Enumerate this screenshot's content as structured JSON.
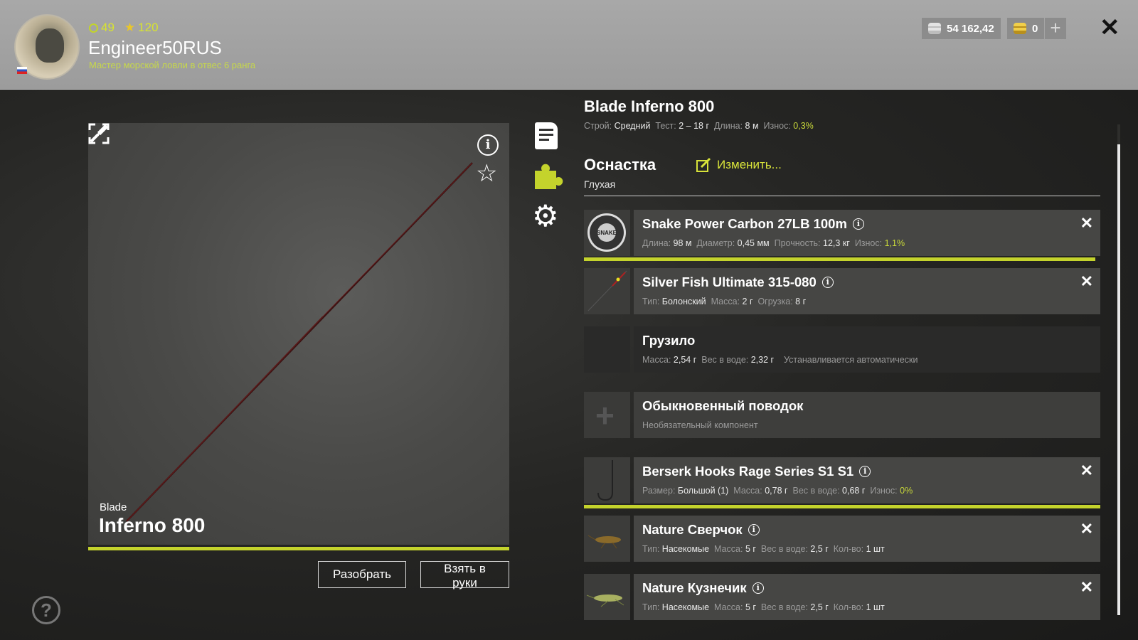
{
  "header": {
    "level": "49",
    "stars": "120",
    "username": "Engineer50RUS",
    "rank": "Мастер морской ловли в отвес 6 ранга",
    "silver": "54 162,42",
    "gold": "0",
    "add_label": "+",
    "close_label": "✕"
  },
  "preview": {
    "brand": "Blade",
    "model": "Inferno 800",
    "info_label": "i",
    "fav_label": "☆",
    "disassemble": "Разобрать",
    "take": "Взять в руки",
    "help_label": "?"
  },
  "item": {
    "title": "Blade Inferno 800",
    "stats": {
      "action_label": "Строй:",
      "action": "Средний",
      "test_label": "Тест:",
      "test": "2 – 18 г",
      "length_label": "Длина:",
      "length": "8 м",
      "wear_label": "Износ:",
      "wear": "0,3%"
    }
  },
  "rig": {
    "title": "Оснастка",
    "subtitle": "Глухая",
    "edit": "Изменить..."
  },
  "components": [
    {
      "name": "Snake Power Carbon 27LB 100m",
      "has_info": true,
      "removable": true,
      "wear_fraction": 0.99,
      "details": [
        [
          "Длина:",
          "98 м"
        ],
        [
          "Диаметр:",
          "0,45 мм"
        ],
        [
          "Прочность:",
          "12,3 кг"
        ],
        [
          "Износ:",
          "1,1%"
        ]
      ]
    },
    {
      "name": "Silver Fish Ultimate 315-080",
      "has_info": true,
      "removable": true,
      "details": [
        [
          "Тип:",
          "Болонский"
        ],
        [
          "Масса:",
          "2 г"
        ],
        [
          "Огрузка:",
          "8 г"
        ]
      ]
    },
    {
      "name": "Грузило",
      "has_info": false,
      "removable": false,
      "details": [
        [
          "Масса:",
          "2,54 г"
        ],
        [
          "Вес в воде:",
          "2,32 г"
        ]
      ],
      "note": "Устанавливается автоматически"
    },
    {
      "name": "Обыкновенный поводок",
      "has_info": false,
      "removable": false,
      "note": "Необязательный компонент"
    },
    {
      "name": "Berserk Hooks Rage Series S1 S1",
      "has_info": true,
      "removable": true,
      "wear_fraction": 1.0,
      "details": [
        [
          "Размер:",
          "Большой (1)"
        ],
        [
          "Масса:",
          "0,78 г"
        ],
        [
          "Вес в воде:",
          "0,68 г"
        ],
        [
          "Износ:",
          "0%"
        ]
      ]
    },
    {
      "name": "Nature Сверчок",
      "has_info": true,
      "removable": true,
      "details": [
        [
          "Тип:",
          "Насекомые"
        ],
        [
          "Масса:",
          "5 г"
        ],
        [
          "Вес в воде:",
          "2,5 г"
        ],
        [
          "Кол-во:",
          "1 шт"
        ]
      ]
    },
    {
      "name": "Nature Кузнечик",
      "has_info": true,
      "removable": true,
      "details": [
        [
          "Тип:",
          "Насекомые"
        ],
        [
          "Масса:",
          "5 г"
        ],
        [
          "Вес в воде:",
          "2,5 г"
        ],
        [
          "Кол-во:",
          "1 шт"
        ]
      ]
    }
  ],
  "colors": {
    "accent": "#c4d32c",
    "header_bg": "#a0a0a0",
    "wear_good": "#c8d83a"
  }
}
